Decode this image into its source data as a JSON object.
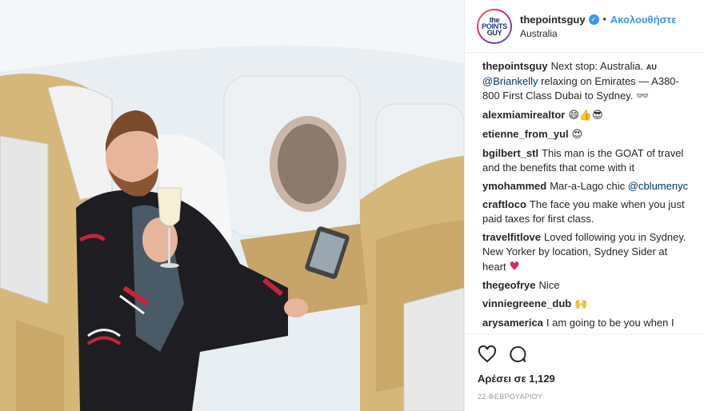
{
  "header": {
    "avatar_text_1": "the",
    "avatar_text_2": "POINTS",
    "avatar_text_3": "GUY",
    "username": "thepointsguy",
    "separator": "•",
    "follow_label": "Ακολουθήστε",
    "location": "Australia"
  },
  "caption": {
    "user": "thepointsguy",
    "text_1": "Next stop: Australia. ",
    "flag": "AU",
    "mention": "@Briankelly",
    "text_2": " relaxing on Emirates — A380-800 First Class Dubai to Sydney. ",
    "emoji": "👓"
  },
  "comments": [
    {
      "user": "alexmiamirealtor",
      "text": "",
      "emoji": "😄👍😎"
    },
    {
      "user": "etienne_from_yul",
      "text": "",
      "emoji": "😍"
    },
    {
      "user": "bgilbert_stl",
      "text": "This man is the GOAT of travel and the benefits that come with it",
      "emoji": ""
    },
    {
      "user": "ymohammed",
      "text": "Mar-a-Lago chic ",
      "mention": "@cblumenyc",
      "emoji": ""
    },
    {
      "user": "craftloco",
      "text": "The face you make when you just paid taxes for first class.",
      "emoji": ""
    },
    {
      "user": "travelfitlove",
      "text": "Loved following you in Sydney. New Yorker by location, Sydney Sider at heart ",
      "emoji": "♥"
    },
    {
      "user": "thegeofrye",
      "text": "Nice",
      "emoji": ""
    },
    {
      "user": "vinniegreene_dub",
      "text": "",
      "emoji": "🙌"
    },
    {
      "user": "arysamerica",
      "text": "I am going to be you when I grow up",
      "emoji": ""
    }
  ],
  "actions": {
    "likes": "Αρέσει σε 1,129",
    "date": "22 ΦΕΒΡΟΥΑΡΙΟΥ"
  },
  "icons": {
    "like": "heart-icon",
    "comment": "speech-bubble-icon",
    "verified": "verified-badge-icon"
  },
  "colors": {
    "link": "#3897f0",
    "mention": "#003569",
    "heart_emoji": "#e0245e"
  }
}
